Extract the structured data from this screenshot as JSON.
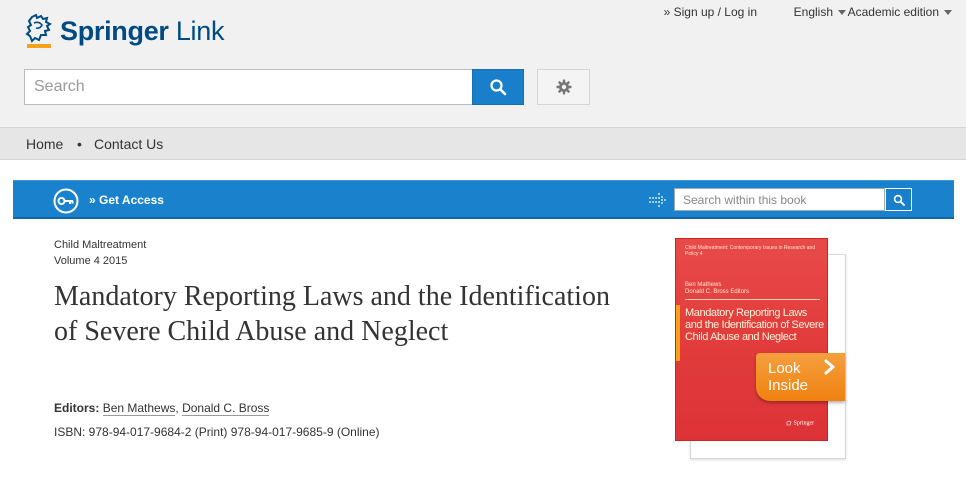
{
  "brand": {
    "name_bold": "Springer",
    "name_light": " Link"
  },
  "top_links": {
    "signup": "» Sign up / Log in",
    "language": "English",
    "edition": "Academic edition"
  },
  "search": {
    "placeholder": "Search"
  },
  "nav": {
    "home": "Home",
    "separator": "•",
    "contact": "Contact Us"
  },
  "access_bar": {
    "get_access": "» Get Access",
    "search_within_placeholder": "Search within this book"
  },
  "book": {
    "series": "Child Maltreatment",
    "volume": "Volume 4 2015",
    "title": "Mandatory Reporting Laws and the Identification of Severe Child Abuse and Neglect",
    "editors_label": "Editors:",
    "editor_1": "Ben Mathews",
    "editor_sep": ", ",
    "editor_2": "Donald C. Bross",
    "isbn": "ISBN: 978-94-017-9684-2 (Print) 978-94-017-9685-9 (Online)"
  },
  "cover": {
    "series_text": "Child Maltreatment: Contemporary Issues in Research and Policy 4",
    "authors_line1": "Ben Mathews",
    "authors_line2": "Donald C. Bross Editors",
    "title": "Mandatory Reporting Laws and the Identification of Severe Child Abuse and Neglect",
    "publisher": "Springer",
    "look_inside_line1": "Look",
    "look_inside_line2": "Inside"
  },
  "colors": {
    "brand_blue": "#004b83",
    "access_blue": "#1a82cd",
    "button_blue": "#1a7fcb",
    "logo_orange": "#f6a21b",
    "cover_red": "#e23c3c",
    "look_inside_orange": "#ef8210"
  }
}
